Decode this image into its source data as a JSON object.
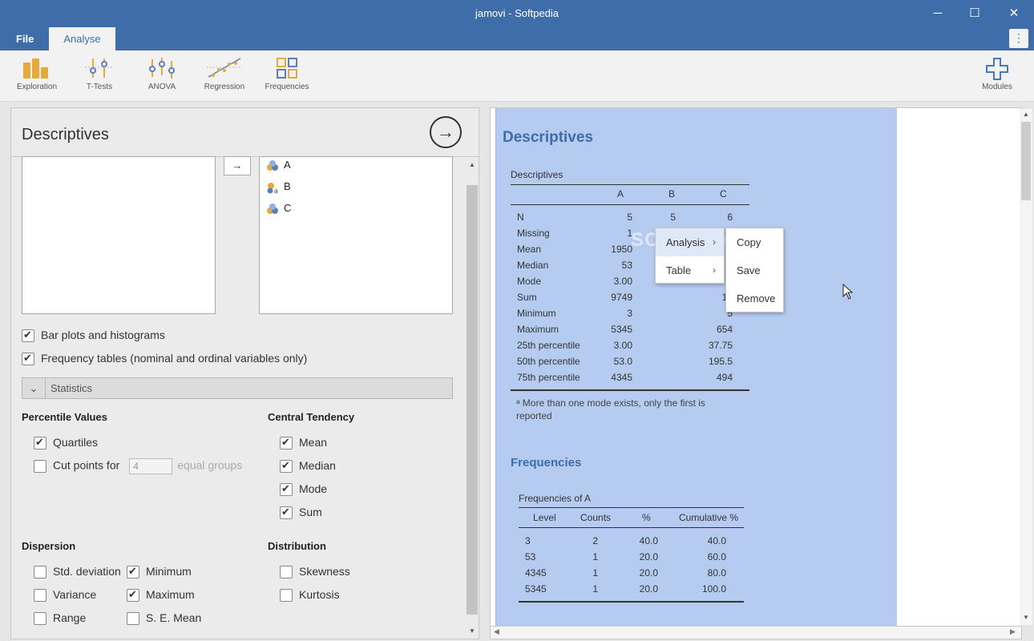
{
  "window": {
    "title": "jamovi - Softpedia",
    "minimize": "─",
    "maximize": "☐",
    "close": "✕"
  },
  "menu": {
    "file": "File",
    "analyse": "Analyse",
    "more": "⋮"
  },
  "ribbon": {
    "buttons": [
      {
        "label": "Exploration",
        "icon": "exploration-icon"
      },
      {
        "label": "T-Tests",
        "icon": "t-tests-icon"
      },
      {
        "label": "ANOVA",
        "icon": "anova-icon"
      },
      {
        "label": "Regression",
        "icon": "regression-icon"
      },
      {
        "label": "Frequencies",
        "icon": "frequencies-icon"
      }
    ],
    "modules": {
      "label": "Modules",
      "icon": "plus-icon"
    }
  },
  "options": {
    "title": "Descriptives",
    "run_arrow": "→",
    "move_arrow": "→",
    "variables": [
      {
        "name": "A",
        "icon": "continuous-variable-icon"
      },
      {
        "name": "B",
        "icon": "nominal-text-variable-icon"
      },
      {
        "name": "C",
        "icon": "continuous-variable-icon"
      }
    ],
    "bar_plots": {
      "label": "Bar plots and histograms",
      "checked": true
    },
    "freq_tables": {
      "label": "Frequency tables (nominal and ordinal variables only)",
      "checked": true
    },
    "statistics_section": {
      "label": "Statistics",
      "chevron": "⌄"
    },
    "percentile": {
      "heading": "Percentile Values",
      "quartiles": {
        "label": "Quartiles",
        "checked": true
      },
      "cut_points": {
        "label": "Cut points for",
        "value": "4",
        "suffix": "equal groups",
        "checked": false
      }
    },
    "central": {
      "heading": "Central Tendency",
      "items": [
        {
          "label": "Mean",
          "checked": true
        },
        {
          "label": "Median",
          "checked": true
        },
        {
          "label": "Mode",
          "checked": true
        },
        {
          "label": "Sum",
          "checked": true
        }
      ]
    },
    "dispersion": {
      "heading": "Dispersion",
      "items": [
        {
          "label": "Std. deviation",
          "checked": false
        },
        {
          "label": "Minimum",
          "checked": true
        },
        {
          "label": "Variance",
          "checked": false
        },
        {
          "label": "Maximum",
          "checked": true
        },
        {
          "label": "Range",
          "checked": false
        },
        {
          "label": "S. E. Mean",
          "checked": false
        }
      ]
    },
    "distribution": {
      "heading": "Distribution",
      "items": [
        {
          "label": "Skewness",
          "checked": false
        },
        {
          "label": "Kurtosis",
          "checked": false
        }
      ]
    }
  },
  "results": {
    "heading": "Descriptives",
    "table_caption": "Descriptives",
    "columns": [
      "A",
      "B",
      "C"
    ],
    "rows": [
      {
        "label": "N",
        "A": "5",
        "B": "5",
        "C": "6"
      },
      {
        "label": "Missing",
        "A": "1",
        "B": "",
        "C": ""
      },
      {
        "label": "Mean",
        "A": "1950",
        "B": "",
        "C": ""
      },
      {
        "label": "Median",
        "A": "53",
        "B": "",
        "C": ""
      },
      {
        "label": "Mode",
        "A": "3.00",
        "B": "",
        "C": ""
      },
      {
        "label": "Sum",
        "A": "9749",
        "B": "",
        "C": "16"
      },
      {
        "label": "Minimum",
        "A": "3",
        "B": "",
        "C": "5"
      },
      {
        "label": "Maximum",
        "A": "5345",
        "B": "",
        "C": "654"
      },
      {
        "label": "25th percentile",
        "A": "3.00",
        "B": "",
        "C": "37.75"
      },
      {
        "label": "50th percentile",
        "A": "53.0",
        "B": "",
        "C": "195.5"
      },
      {
        "label": "75th percentile",
        "A": "4345",
        "B": "",
        "C": "494"
      }
    ],
    "footnote": "ᵃ More than one mode exists, only the first is reported",
    "freq_heading": "Frequencies",
    "freq_caption": "Frequencies of A",
    "freq_columns": [
      "Level",
      "Counts",
      "%",
      "Cumulative %"
    ],
    "freq_rows": [
      {
        "level": "3",
        "counts": "2",
        "pct": "40.0",
        "cum": "40.0"
      },
      {
        "level": "53",
        "counts": "1",
        "pct": "20.0",
        "cum": "60.0"
      },
      {
        "level": "4345",
        "counts": "1",
        "pct": "20.0",
        "cum": "80.0"
      },
      {
        "level": "5345",
        "counts": "1",
        "pct": "20.0",
        "cum": "100.0"
      }
    ]
  },
  "context_menu": {
    "items": [
      {
        "label": "Analysis",
        "chevron": "›"
      },
      {
        "label": "Table",
        "chevron": "›"
      }
    ],
    "submenu": [
      "Copy",
      "Save",
      "Remove"
    ]
  },
  "watermark": "SOFTPEDIA",
  "colors": {
    "accent": "#3e6da9",
    "selection": "#b5cbf0",
    "ribbon_icon": "#e8a93b"
  }
}
